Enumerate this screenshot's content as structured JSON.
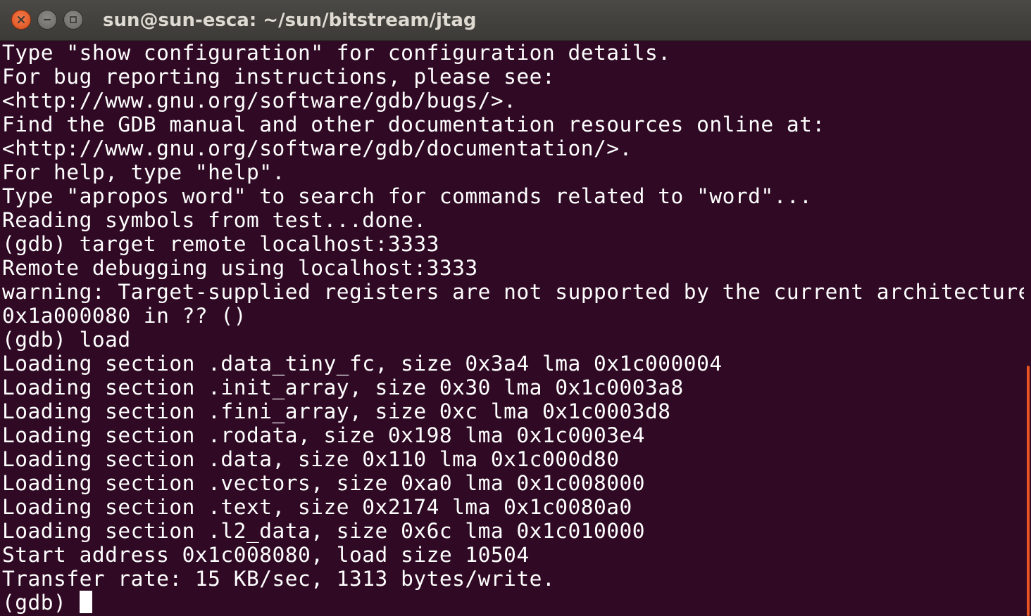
{
  "window": {
    "title": "sun@sun-esca: ~/sun/bitstream/jtag",
    "buttons": {
      "close_icon": "close-icon",
      "minimize_icon": "minimize-icon",
      "maximize_icon": "maximize-icon"
    }
  },
  "terminal": {
    "lines": [
      "Type \"show configuration\" for configuration details.",
      "For bug reporting instructions, please see:",
      "<http://www.gnu.org/software/gdb/bugs/>.",
      "Find the GDB manual and other documentation resources online at:",
      "<http://www.gnu.org/software/gdb/documentation/>.",
      "For help, type \"help\".",
      "Type \"apropos word\" to search for commands related to \"word\"...",
      "Reading symbols from test...done.",
      "(gdb) target remote localhost:3333",
      "Remote debugging using localhost:3333",
      "warning: Target-supplied registers are not supported by the current architecture",
      "0x1a000080 in ?? ()",
      "(gdb) load",
      "Loading section .data_tiny_fc, size 0x3a4 lma 0x1c000004",
      "Loading section .init_array, size 0x30 lma 0x1c0003a8",
      "Loading section .fini_array, size 0xc lma 0x1c0003d8",
      "Loading section .rodata, size 0x198 lma 0x1c0003e4",
      "Loading section .data, size 0x110 lma 0x1c000d80",
      "Loading section .vectors, size 0xa0 lma 0x1c008000",
      "Loading section .text, size 0x2174 lma 0x1c0080a0",
      "Loading section .l2_data, size 0x6c lma 0x1c010000",
      "Start address 0x1c008080, load size 10504",
      "Transfer rate: 15 KB/sec, 1313 bytes/write."
    ],
    "prompt": "(gdb) "
  },
  "colors": {
    "background": "#300a24",
    "text": "#ffffff",
    "titlebar": "#3c3b37",
    "close_button": "#e95420",
    "scrollbar_thumb": "#e95420"
  }
}
